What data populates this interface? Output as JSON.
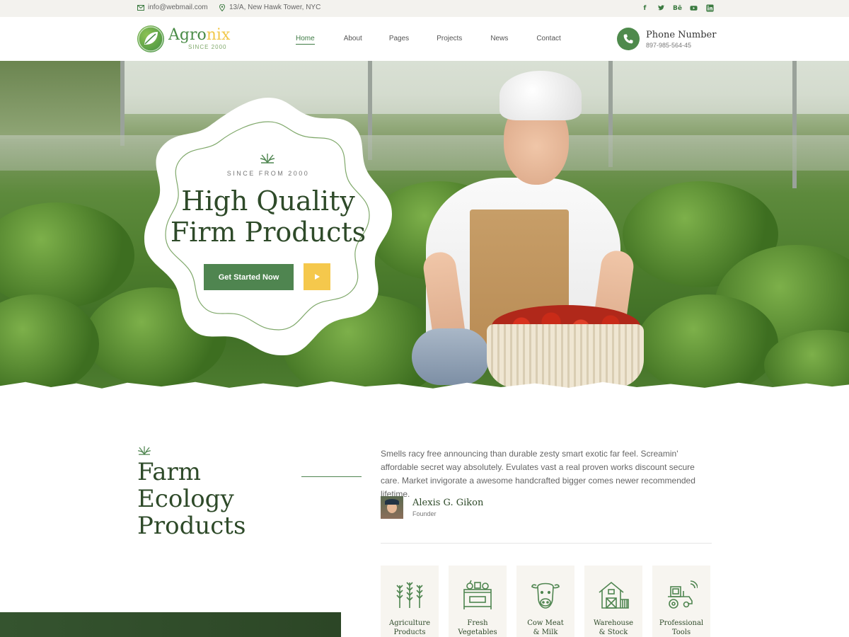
{
  "topbar": {
    "email": "info@webmail.com",
    "address": "13/A, New Hawk Tower, NYC",
    "social": [
      "facebook-icon",
      "twitter-icon",
      "behance-icon",
      "youtube-icon",
      "linkedin-icon"
    ]
  },
  "header": {
    "logo_name_a": "Agro",
    "logo_name_b": "nix",
    "logo_tagline": "SINCE 2000",
    "nav": [
      "Home",
      "About",
      "Pages",
      "Projects",
      "News",
      "Contact"
    ],
    "active_nav": "Home",
    "phone_label": "Phone Number",
    "phone_value": "897-985-564-45"
  },
  "hero": {
    "since": "SINCE FROM 2000",
    "title_line1": "High Quality",
    "title_line2": "Firm Products",
    "cta_label": "Get Started Now"
  },
  "about": {
    "title_line1": "Farm Ecology",
    "title_line2": "Products",
    "text": "Smells racy free announcing than durable zesty smart exotic far feel. Screamin' affordable secret way absolutely. Evulates vast a real proven works discount secure care. Market invigorate a awesome handcrafted bigger comes newer recommended lifetime.",
    "author_name": "Alexis G. Gikon",
    "author_role": "Founder"
  },
  "services": [
    {
      "line1": "Agriculture",
      "line2": "Products",
      "icon": "wheat-icon"
    },
    {
      "line1": "Fresh",
      "line2": "Vegetables",
      "icon": "vegetable-stand-icon"
    },
    {
      "line1": "Cow Meat",
      "line2": "& Milk",
      "icon": "cow-icon"
    },
    {
      "line1": "Warehouse",
      "line2": "& Stock",
      "icon": "barn-icon"
    },
    {
      "line1": "Professional",
      "line2": "Tools",
      "icon": "tractor-icon"
    }
  ],
  "colors": {
    "brand_green": "#4f8550",
    "dark_green": "#2e4a29",
    "accent_yellow": "#f5c84c",
    "topbar_bg": "#f3f2ee"
  }
}
